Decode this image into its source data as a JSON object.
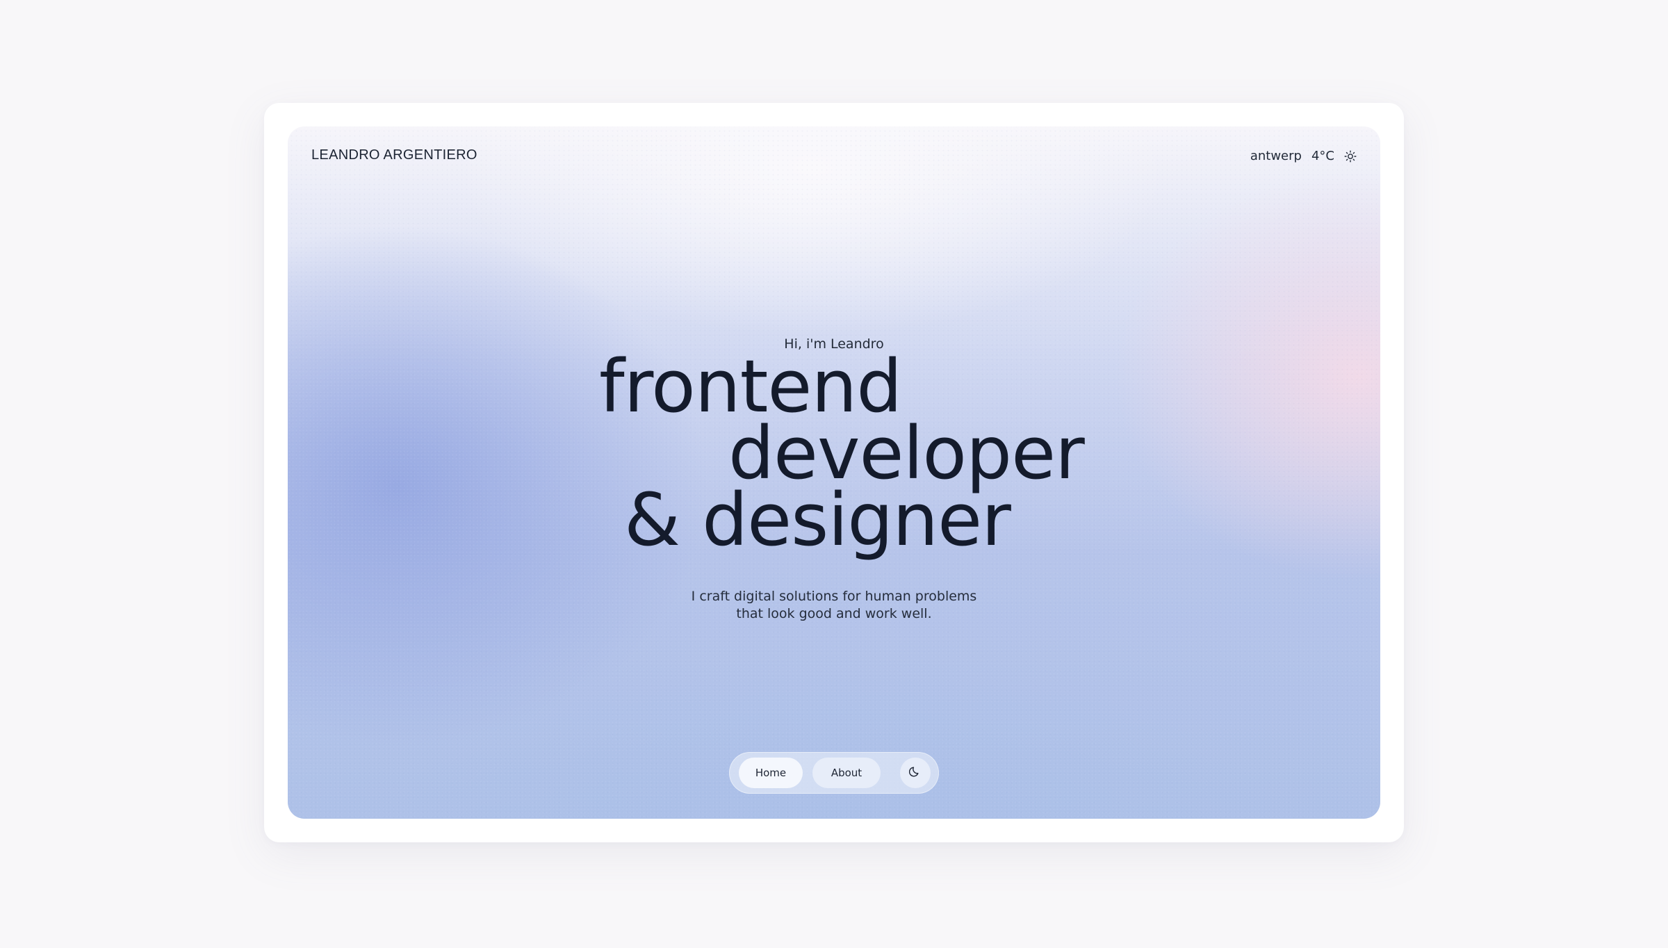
{
  "header": {
    "brand": "LEANDRO ARGENTIERO",
    "city": "antwerp",
    "temperature": "4°C",
    "weather_icon": "sun-icon"
  },
  "hero": {
    "greeting": "Hi, i'm Leandro",
    "headline": [
      "frontend",
      "developer",
      "& designer"
    ],
    "tagline": [
      "I craft digital solutions for human problems",
      "that look good and work well."
    ]
  },
  "nav": {
    "home_label": "Home",
    "about_label": "About",
    "theme_icon": "moon-icon"
  },
  "colors": {
    "text": "#141b2c",
    "background_page": "#f8f7f9",
    "gradient_blue": "#aec1e8",
    "gradient_pink": "#f3dae8"
  }
}
